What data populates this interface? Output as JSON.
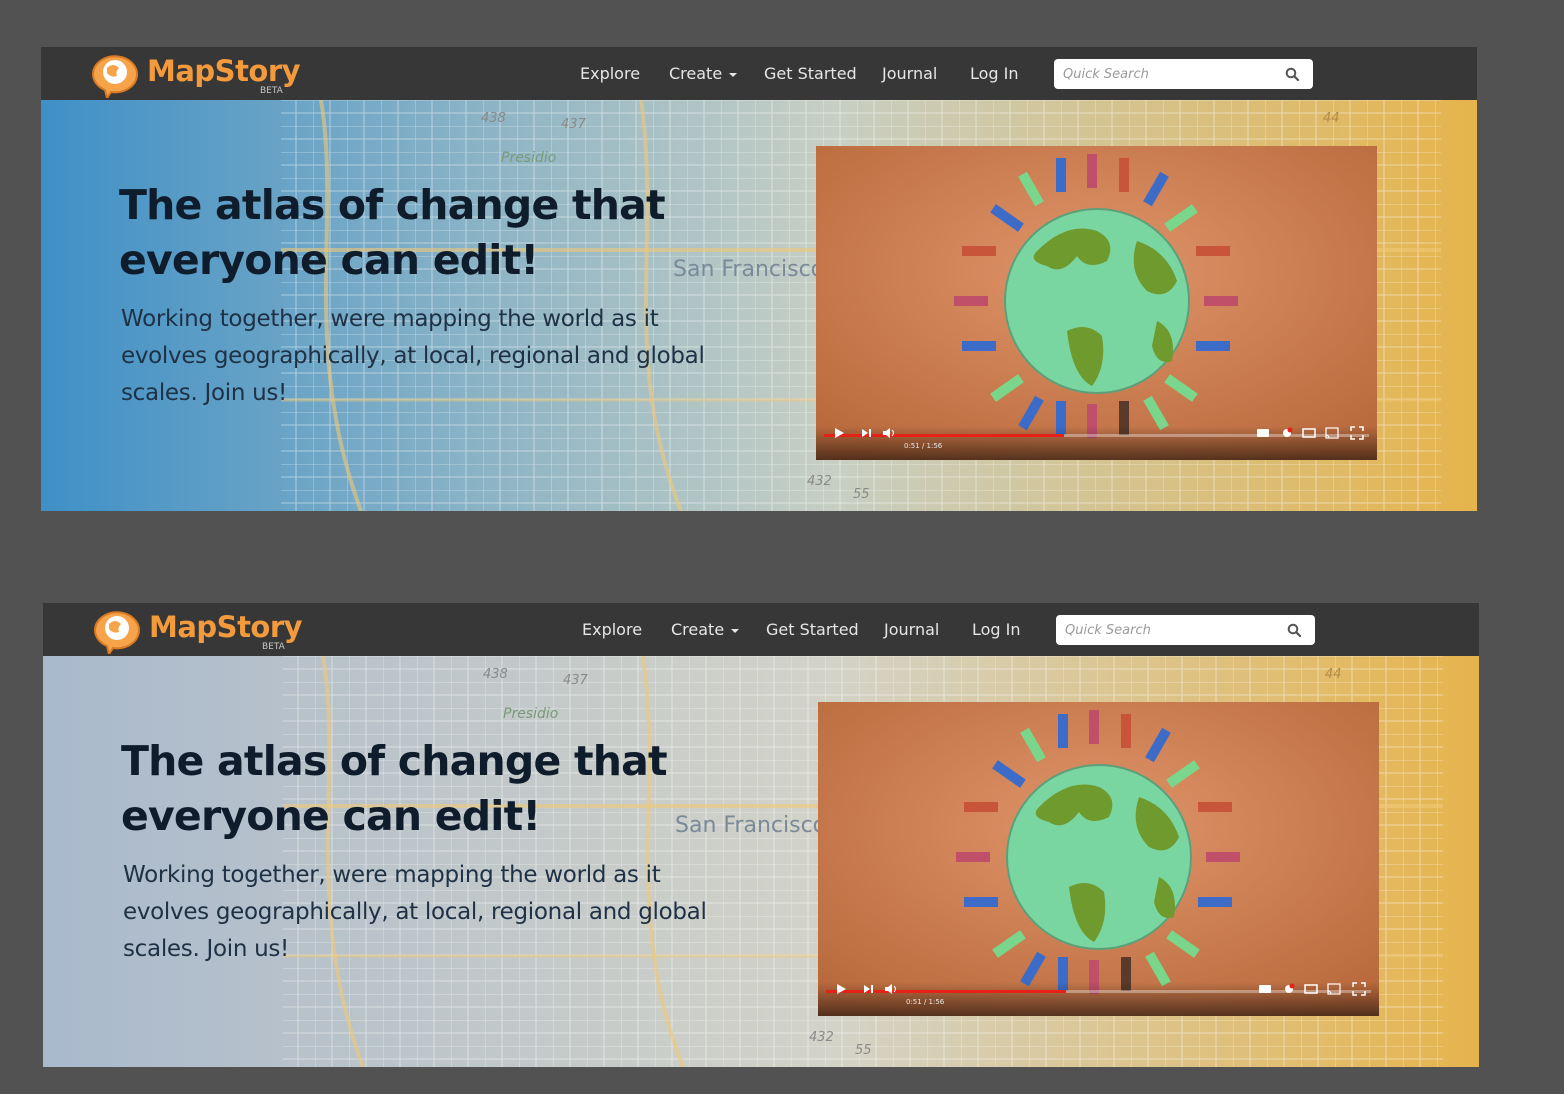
{
  "panels": [
    {
      "brand": {
        "name": "MapStory",
        "tag": "BETA"
      },
      "nav": {
        "explore": "Explore",
        "create": "Create",
        "get_started": "Get Started",
        "journal": "Journal",
        "login": "Log In"
      },
      "search": {
        "placeholder": "Quick Search",
        "icon": "search-icon"
      },
      "hero": {
        "heading": "The atlas of change that everyone can edit!",
        "lead": "Working together, were mapping the world as it evolves geographically, at local, regional and global scales. Join us!",
        "map_labels": {
          "city": "San Francisco",
          "park": "Presidio",
          "road1": "438",
          "road2": "437",
          "road3": "432",
          "road4": "55",
          "road5": "44"
        },
        "gradient": {
          "from": "#3f90c7",
          "to": "#e6b44c"
        }
      },
      "video": {
        "time": "0:51 / 1:56",
        "progress": 0.44
      }
    },
    {
      "brand": {
        "name": "MapStory",
        "tag": "BETA"
      },
      "nav": {
        "explore": "Explore",
        "create": "Create",
        "get_started": "Get Started",
        "journal": "Journal",
        "login": "Log In"
      },
      "search": {
        "placeholder": "Quick Search",
        "icon": "search-icon"
      },
      "hero": {
        "heading": "The atlas of change that everyone can edit!",
        "lead": "Working together, were mapping the world as it evolves geographically, at local, regional and global scales. Join us!",
        "map_labels": {
          "city": "San Francisco",
          "park": "Presidio",
          "road1": "438",
          "road2": "437",
          "road3": "432",
          "road4": "55",
          "road5": "44"
        },
        "gradient": {
          "from": "#a9b9cc",
          "to": "#e6b44c"
        }
      },
      "video": {
        "time": "0:51 / 1:56",
        "progress": 0.44
      }
    }
  ]
}
